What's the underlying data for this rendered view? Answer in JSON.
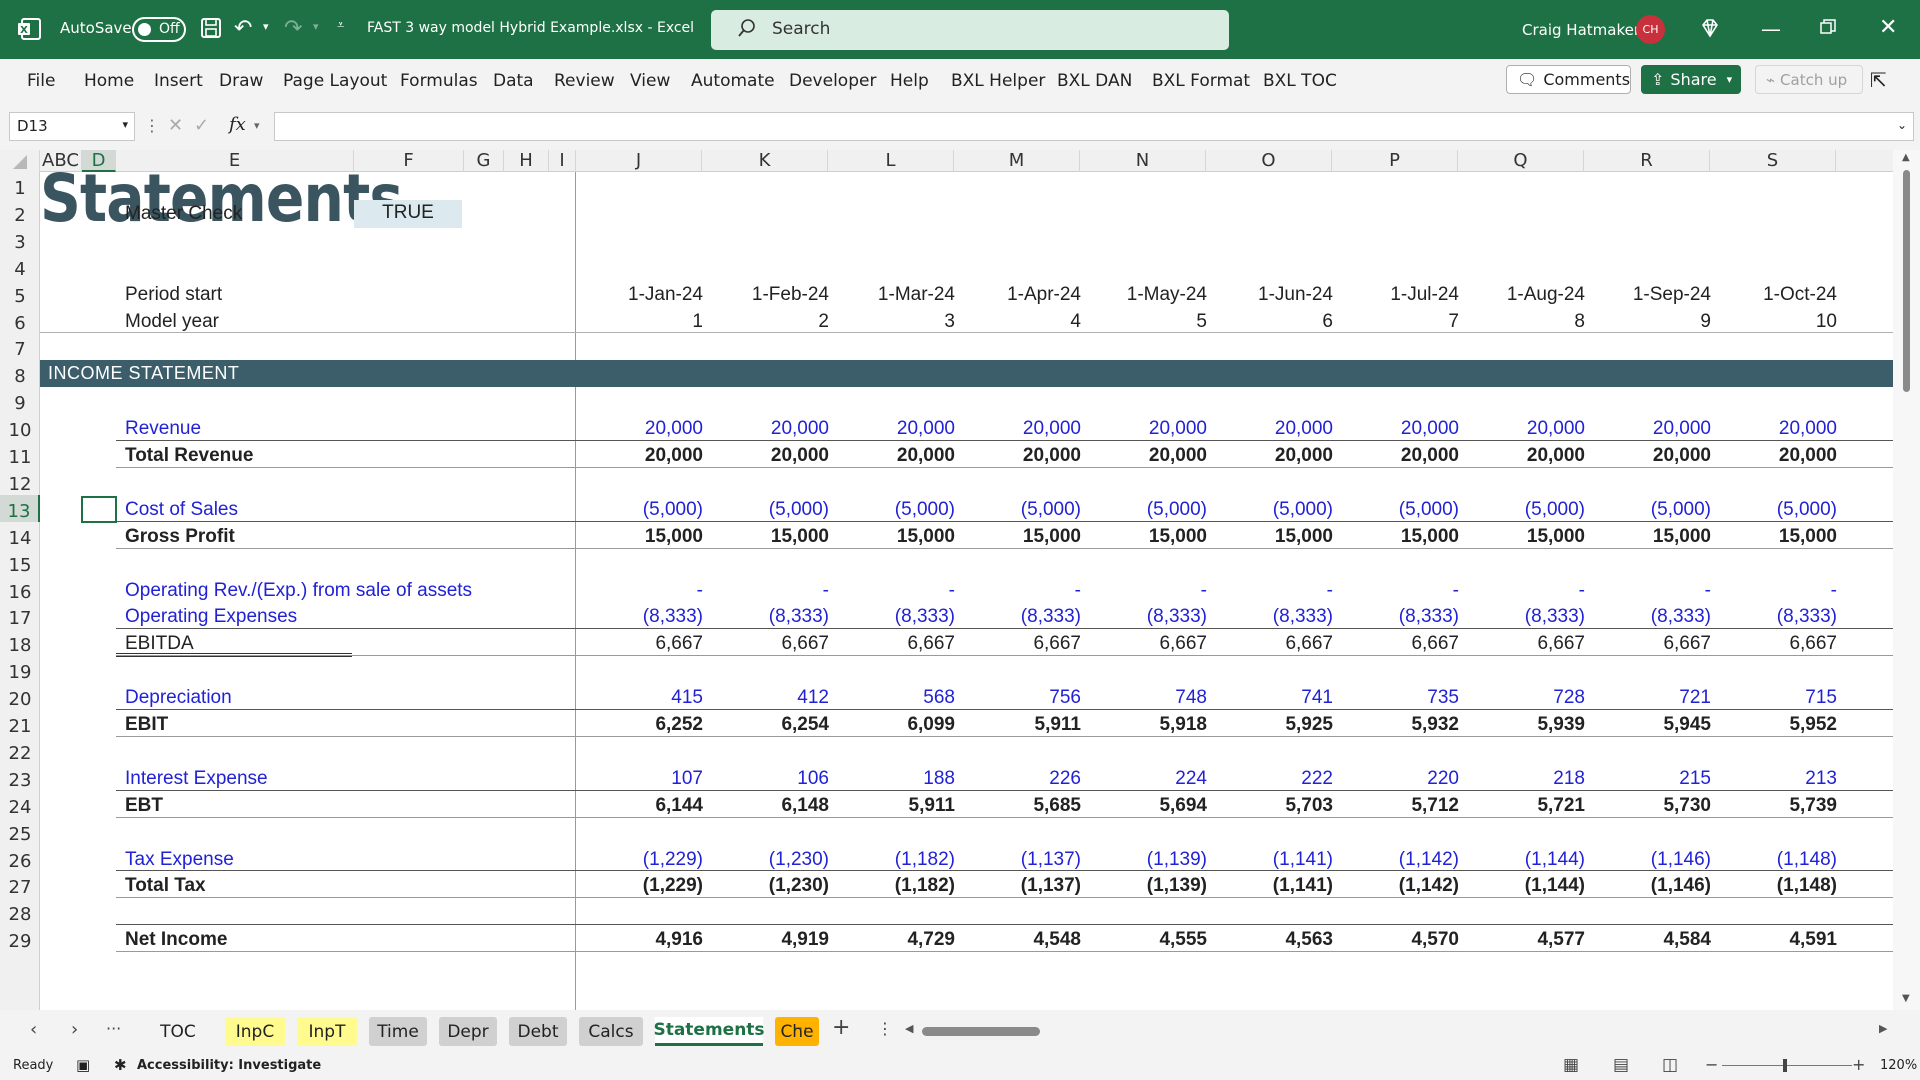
{
  "titlebar": {
    "autosave_label": "AutoSave",
    "autosave_state": "Off",
    "filename": "FAST 3 way model Hybrid Example.xlsx  -  Excel",
    "search_placeholder": "Search",
    "user_name": "Craig Hatmaker",
    "user_initials": "CH",
    "bg_color": "#1e7145"
  },
  "menu": [
    "File",
    "Home",
    "Insert",
    "Draw",
    "Page Layout",
    "Formulas",
    "Data",
    "Review",
    "View",
    "Automate",
    "Developer",
    "Help",
    "BXL Helper",
    "BXL DAN",
    "BXL Format",
    "BXL TOC"
  ],
  "ribbon_buttons": {
    "comments": "Comments",
    "share": "Share",
    "catchup": "Catch up"
  },
  "formula_bar": {
    "name_box": "D13",
    "formula": "",
    "fx": "fx"
  },
  "columns": [
    "ABC",
    "D",
    "E",
    "F",
    "G",
    "H",
    "I",
    "J",
    "K",
    "L",
    "M",
    "N",
    "O",
    "P",
    "Q",
    "R",
    "S"
  ],
  "rows": [
    "1",
    "2",
    "3",
    "4",
    "5",
    "6",
    "7",
    "8",
    "9",
    "10",
    "11",
    "12",
    "13",
    "14",
    "15",
    "16",
    "17",
    "18",
    "19",
    "20",
    "21",
    "22",
    "23",
    "24",
    "25",
    "26",
    "27",
    "28",
    "29"
  ],
  "sheet": {
    "title": "Statements",
    "master_check_label": "Master Check",
    "master_check_value": "TRUE",
    "period_start_label": "Period start",
    "model_year_label": "Model year",
    "dates": [
      "1-Jan-24",
      "1-Feb-24",
      "1-Mar-24",
      "1-Apr-24",
      "1-May-24",
      "1-Jun-24",
      "1-Jul-24",
      "1-Aug-24",
      "1-Sep-24",
      "1-Oct-24"
    ],
    "model_years": [
      "1",
      "2",
      "3",
      "4",
      "5",
      "6",
      "7",
      "8",
      "9",
      "10"
    ],
    "section_header": "INCOME STATEMENT",
    "section_color": "#3c5e6b",
    "lines": [
      {
        "label": "Revenue",
        "style": "blue",
        "values": [
          "20,000",
          "20,000",
          "20,000",
          "20,000",
          "20,000",
          "20,000",
          "20,000",
          "20,000",
          "20,000",
          "20,000"
        ]
      },
      {
        "label": "Total Revenue",
        "style": "bold",
        "values": [
          "20,000",
          "20,000",
          "20,000",
          "20,000",
          "20,000",
          "20,000",
          "20,000",
          "20,000",
          "20,000",
          "20,000"
        ]
      },
      {
        "label": "Cost of Sales",
        "style": "blue",
        "values": [
          "(5,000)",
          "(5,000)",
          "(5,000)",
          "(5,000)",
          "(5,000)",
          "(5,000)",
          "(5,000)",
          "(5,000)",
          "(5,000)",
          "(5,000)"
        ]
      },
      {
        "label": "Gross Profit",
        "style": "bold",
        "values": [
          "15,000",
          "15,000",
          "15,000",
          "15,000",
          "15,000",
          "15,000",
          "15,000",
          "15,000",
          "15,000",
          "15,000"
        ]
      },
      {
        "label": "Operating Rev./(Exp.) from sale of assets",
        "style": "blue",
        "values": [
          "-",
          "-",
          "-",
          "-",
          "-",
          "-",
          "-",
          "-",
          "-",
          "-"
        ]
      },
      {
        "label": "Operating Expenses",
        "style": "blue",
        "values": [
          "(8,333)",
          "(8,333)",
          "(8,333)",
          "(8,333)",
          "(8,333)",
          "(8,333)",
          "(8,333)",
          "(8,333)",
          "(8,333)",
          "(8,333)"
        ]
      },
      {
        "label": "EBITDA",
        "style": "plain",
        "values": [
          "6,667",
          "6,667",
          "6,667",
          "6,667",
          "6,667",
          "6,667",
          "6,667",
          "6,667",
          "6,667",
          "6,667"
        ]
      },
      {
        "label": "Depreciation",
        "style": "blue",
        "values": [
          "415",
          "412",
          "568",
          "756",
          "748",
          "741",
          "735",
          "728",
          "721",
          "715"
        ]
      },
      {
        "label": "EBIT",
        "style": "bold",
        "values": [
          "6,252",
          "6,254",
          "6,099",
          "5,911",
          "5,918",
          "5,925",
          "5,932",
          "5,939",
          "5,945",
          "5,952"
        ]
      },
      {
        "label": "Interest Expense",
        "style": "blue",
        "values": [
          "107",
          "106",
          "188",
          "226",
          "224",
          "222",
          "220",
          "218",
          "215",
          "213"
        ]
      },
      {
        "label": "EBT",
        "style": "bold",
        "values": [
          "6,144",
          "6,148",
          "5,911",
          "5,685",
          "5,694",
          "5,703",
          "5,712",
          "5,721",
          "5,730",
          "5,739"
        ]
      },
      {
        "label": "Tax Expense",
        "style": "blue",
        "values": [
          "(1,229)",
          "(1,230)",
          "(1,182)",
          "(1,137)",
          "(1,139)",
          "(1,141)",
          "(1,142)",
          "(1,144)",
          "(1,146)",
          "(1,148)"
        ]
      },
      {
        "label": "Total Tax",
        "style": "bold",
        "values": [
          "(1,229)",
          "(1,230)",
          "(1,182)",
          "(1,137)",
          "(1,139)",
          "(1,141)",
          "(1,142)",
          "(1,144)",
          "(1,146)",
          "(1,148)"
        ]
      },
      {
        "label": "Net Income",
        "style": "bold",
        "values": [
          "4,916",
          "4,919",
          "4,729",
          "4,548",
          "4,555",
          "4,563",
          "4,570",
          "4,577",
          "4,584",
          "4,591"
        ]
      }
    ]
  },
  "tabs": [
    {
      "label": "TOC",
      "color": "#f3f3f3"
    },
    {
      "label": "InpC",
      "color": "#fffb8f"
    },
    {
      "label": "InpT",
      "color": "#fffb8f"
    },
    {
      "label": "Time",
      "color": "#d0d0d0"
    },
    {
      "label": "Depr",
      "color": "#d0d0d0"
    },
    {
      "label": "Debt",
      "color": "#d0d0d0"
    },
    {
      "label": "Calcs",
      "color": "#d0d0d0"
    },
    {
      "label": "Statements",
      "color": "#ffffff",
      "active": true
    },
    {
      "label": "Che",
      "color": "#ffb300"
    }
  ],
  "status": {
    "ready": "Ready",
    "accessibility": "Accessibility: Investigate",
    "zoom": "120%"
  }
}
